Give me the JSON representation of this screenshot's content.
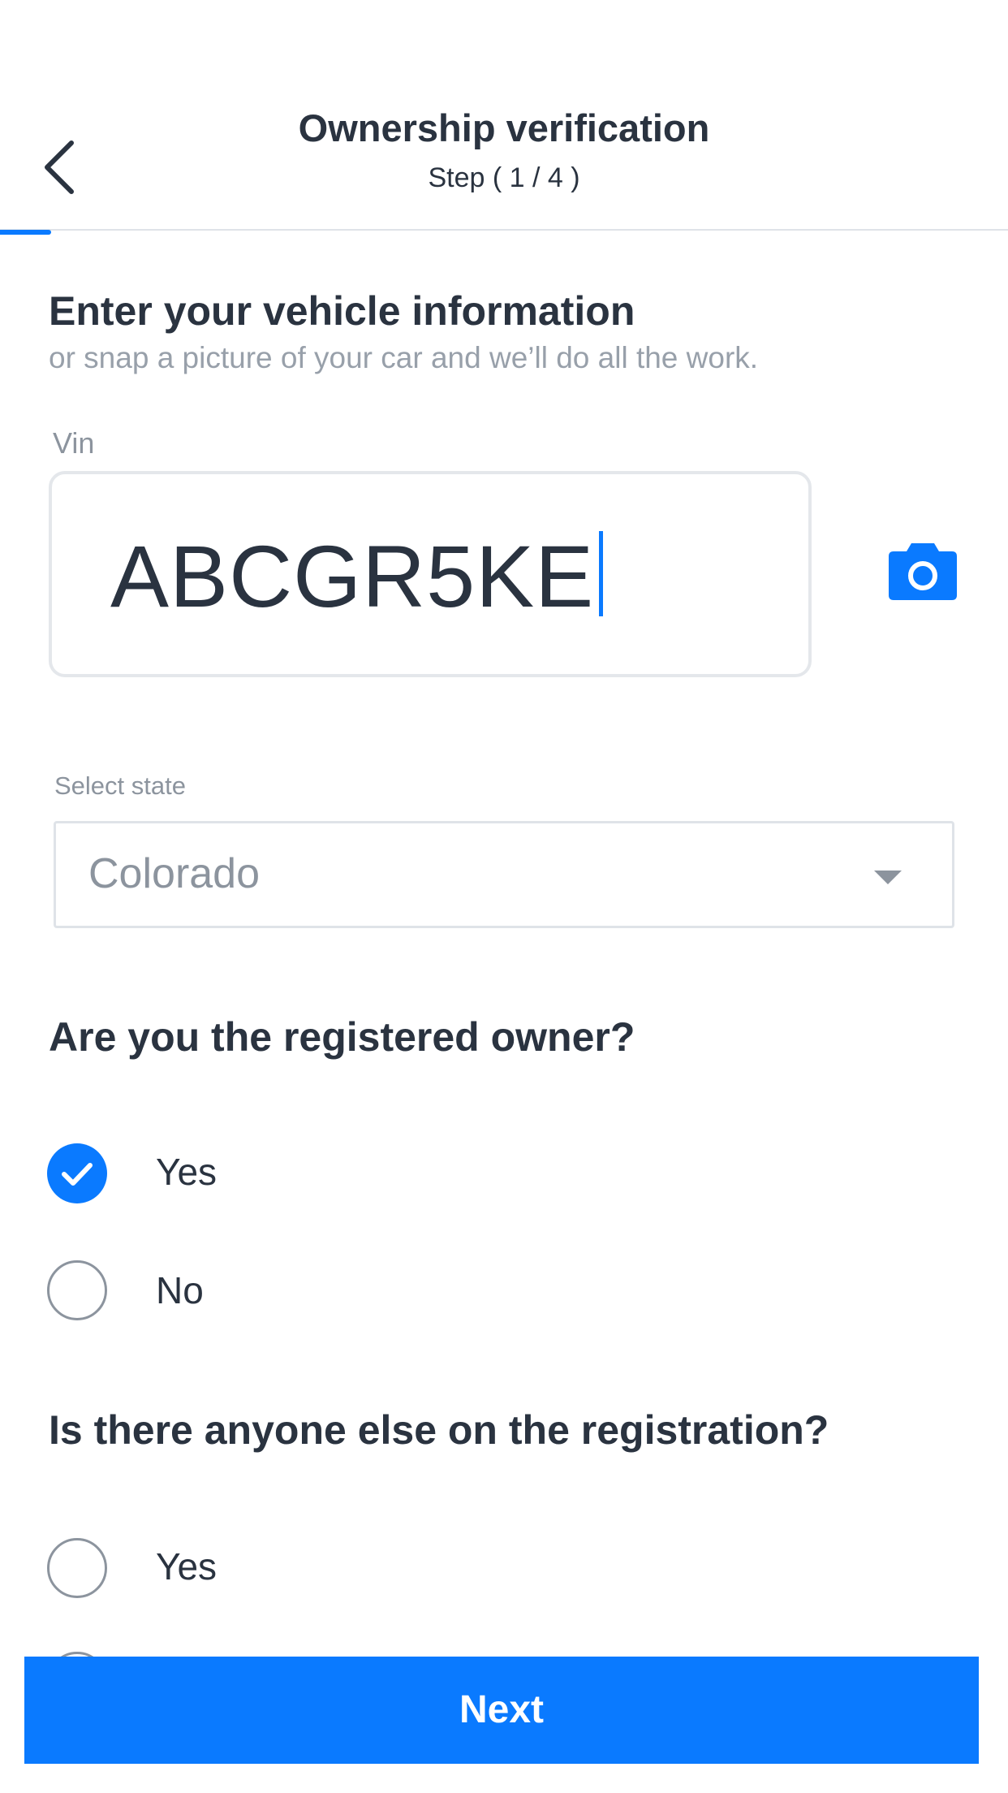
{
  "header": {
    "title": "Ownership verification",
    "step": "Step ( 1 / 4 )",
    "progress_fraction": 0.25
  },
  "intro": {
    "title": "Enter your vehicle information",
    "subtitle": "or snap a picture of your car and we’ll do all the work."
  },
  "vin": {
    "label": "Vin",
    "value": "ABCGR5KE"
  },
  "state": {
    "label": "Select state",
    "selected": "Colorado"
  },
  "question_owner": {
    "title": "Are you the registered owner?",
    "options": [
      {
        "label": "Yes",
        "selected": true
      },
      {
        "label": "No",
        "selected": false
      }
    ]
  },
  "question_other": {
    "title": "Is there anyone else on the registration?",
    "options": [
      {
        "label": "Yes",
        "selected": false
      }
    ]
  },
  "footer": {
    "next_label": "Next"
  },
  "colors": {
    "accent": "#0a7aff",
    "text": "#2a3340",
    "muted": "#8c949e"
  },
  "icons": {
    "back": "chevron-left-icon",
    "camera": "camera-icon",
    "dropdown": "caret-down-icon",
    "check": "check-icon"
  }
}
